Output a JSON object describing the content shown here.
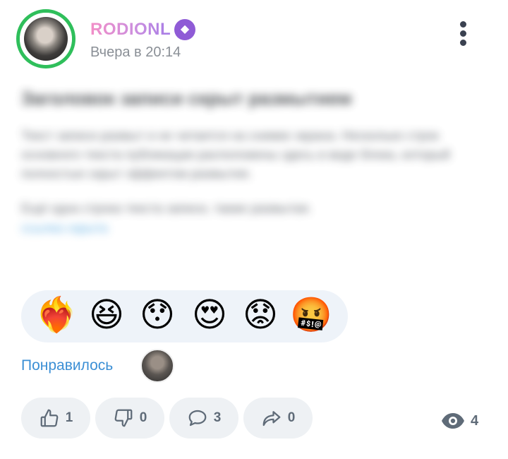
{
  "post": {
    "author": "RODIONL",
    "badge_icon": "award-icon",
    "timestamp": "Вчера в 20:14",
    "title": "Заголовок записи скрыт размытием",
    "paragraph_1": "Текст записи размыт и не читается на снимке экрана. Несколько строк основного текста публикации расположены здесь в виде блока, который полностью скрыт эффектом размытия.",
    "paragraph_2": "Ещё одна строка текста записи, также размытая.",
    "link": "ссылка скрыта"
  },
  "reactions": [
    {
      "name": "heart-on-fire",
      "glyph": "❤️‍🔥"
    },
    {
      "name": "grinning-squinting-face",
      "glyph": "😆"
    },
    {
      "name": "hushed-face",
      "glyph": "😯"
    },
    {
      "name": "heart-eyes-face",
      "glyph": "😍"
    },
    {
      "name": "worried-face",
      "glyph": "😟"
    },
    {
      "name": "cursing-face",
      "glyph": "🤬"
    }
  ],
  "liked": {
    "label": "Понравилось"
  },
  "actions": {
    "like_count": "1",
    "dislike_count": "0",
    "comment_count": "3",
    "share_count": "0"
  },
  "views": {
    "count": "4"
  },
  "colors": {
    "accent": "#3b8fd5",
    "avatar_ring": "#2fbf5b",
    "badge": "#8f5bd6",
    "icon": "#5f6b78"
  }
}
